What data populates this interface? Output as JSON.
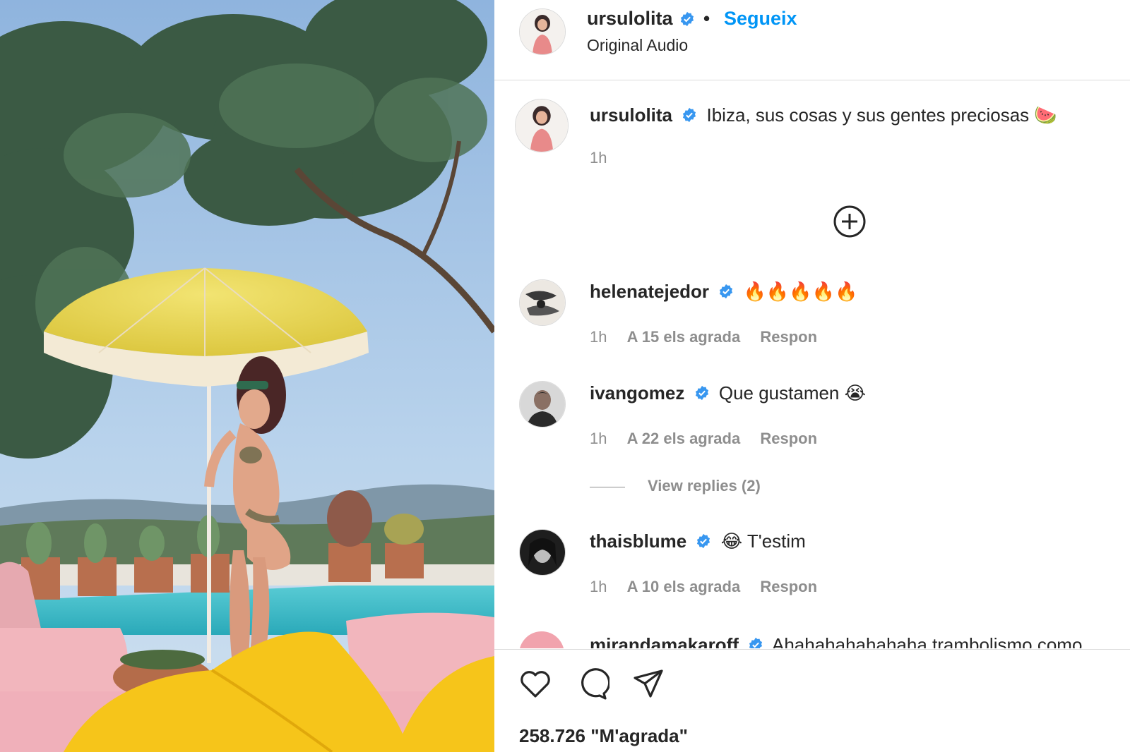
{
  "post": {
    "author": "ursulolita",
    "follow_label": "Segueix",
    "separator": "•",
    "audio": "Original Audio"
  },
  "caption": {
    "username": "ursulolita",
    "text": "Ibiza, sus cosas y sus gentes preciosas",
    "emoji": "🍉",
    "time": "1h"
  },
  "comments": [
    {
      "username": "helenatejedor",
      "text": "🔥🔥🔥🔥🔥",
      "time": "1h",
      "likes": "A 15 els agrada",
      "reply": "Respon"
    },
    {
      "username": "ivangomez",
      "text": "Que gustamen 😭",
      "time": "1h",
      "likes": "A 22 els agrada",
      "reply": "Respon"
    },
    {
      "username": "thaisblume",
      "text": "😂 T'estim",
      "time": "1h",
      "likes": "A 10 els agrada",
      "reply": "Respon"
    }
  ],
  "view_replies": "View replies (2)",
  "partial_comment": {
    "username": "mirandamakaroff",
    "text": "Ahahahahahahaha trambolismo como"
  },
  "likes_count": "258.726 \"M'agrada\"",
  "colors": {
    "accent": "#0095f6",
    "verified": "#3897f0",
    "muted": "#8e8e8e",
    "divider": "#dbdbdb"
  },
  "icons": [
    "verified-badge-icon",
    "add-comment-icon",
    "heart-icon",
    "comment-icon",
    "share-icon"
  ]
}
